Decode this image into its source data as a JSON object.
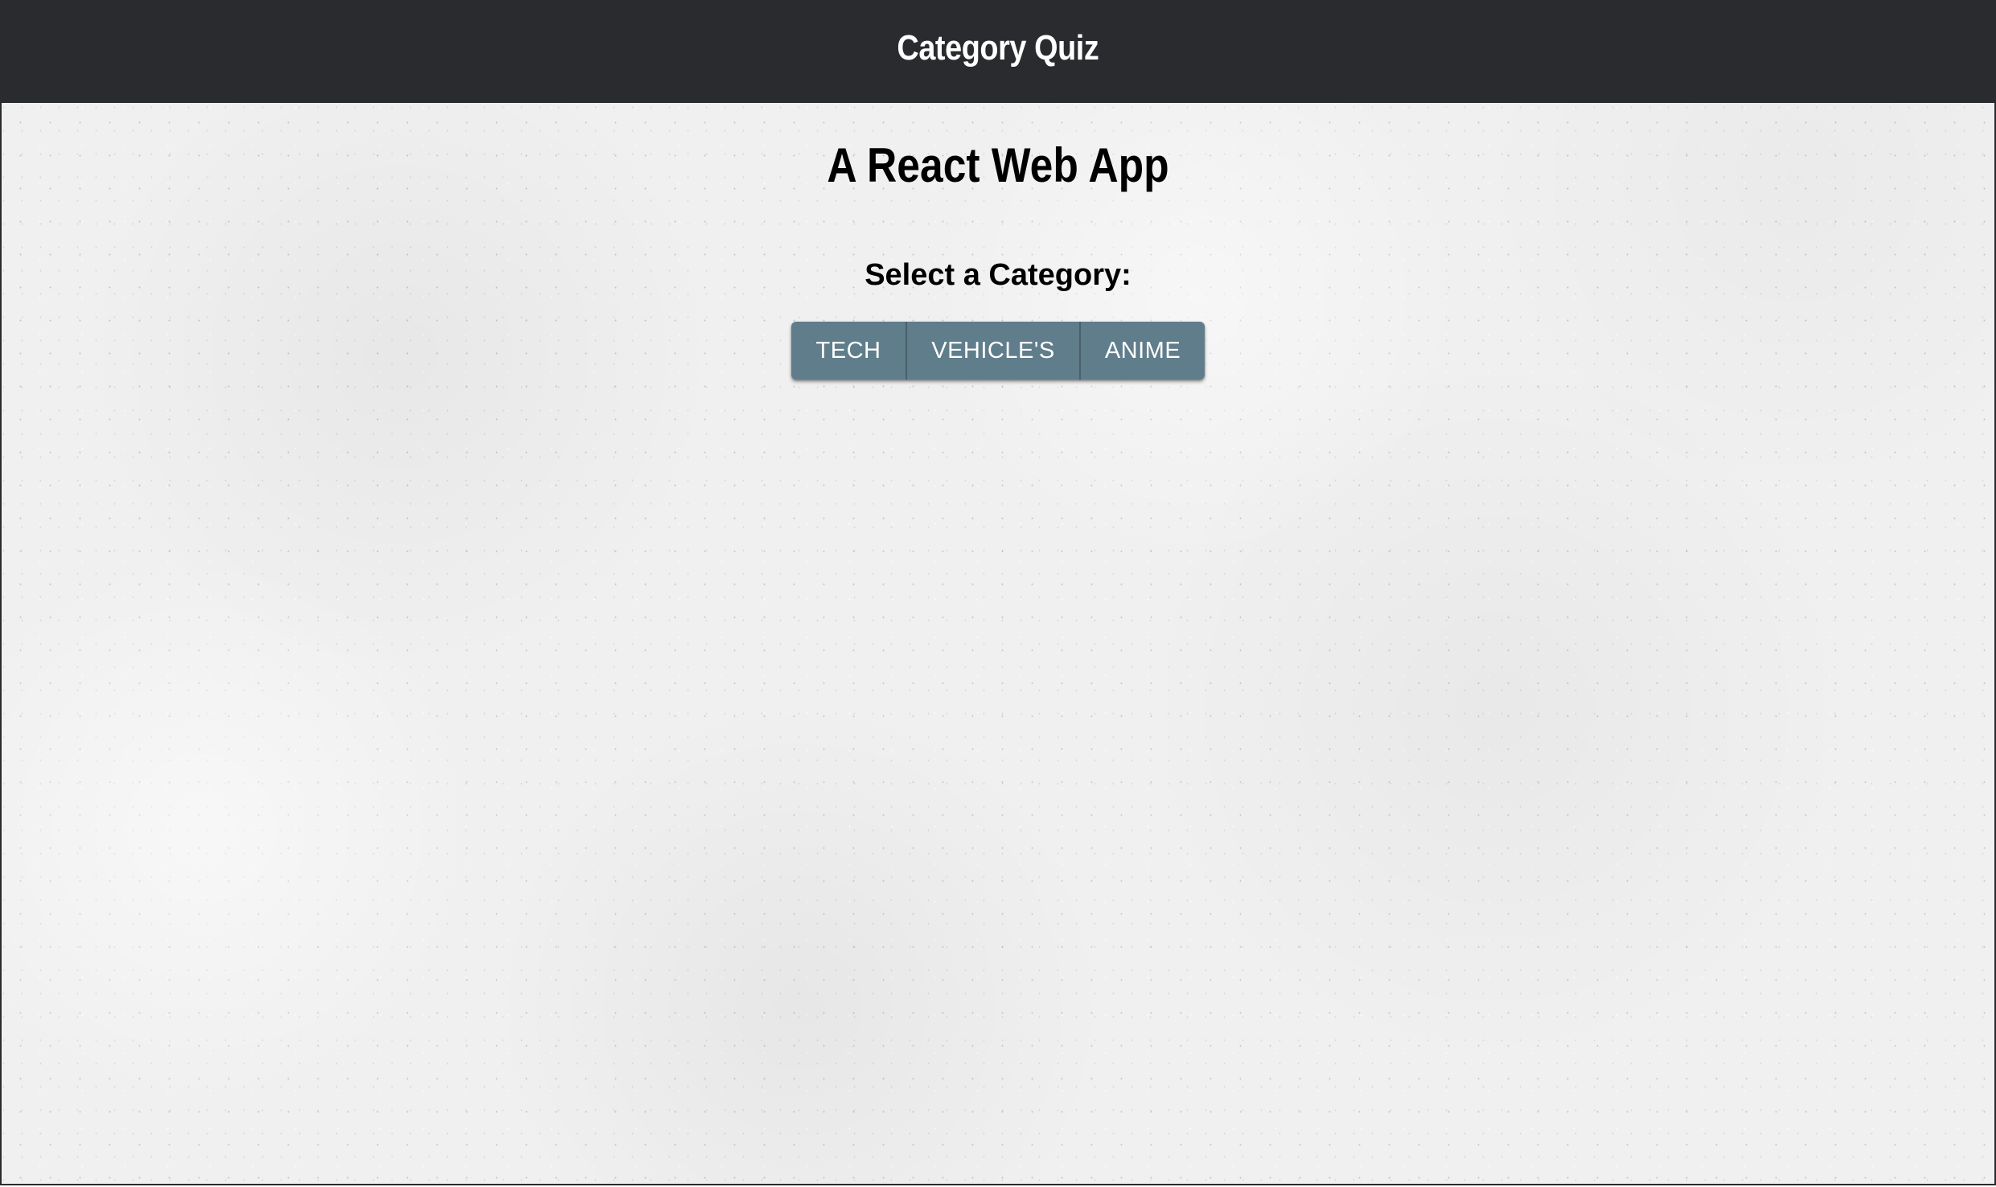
{
  "navbar": {
    "title": "Category Quiz"
  },
  "main": {
    "headline": "A React Web App",
    "prompt": "Select a Category:",
    "categories": [
      {
        "label": "TECH"
      },
      {
        "label": "VEHICLE'S"
      },
      {
        "label": "ANIME"
      }
    ]
  },
  "colors": {
    "navbar_bg": "#2a2b2e",
    "button_bg": "#607d8b",
    "page_bg": "#f0f0f0"
  }
}
